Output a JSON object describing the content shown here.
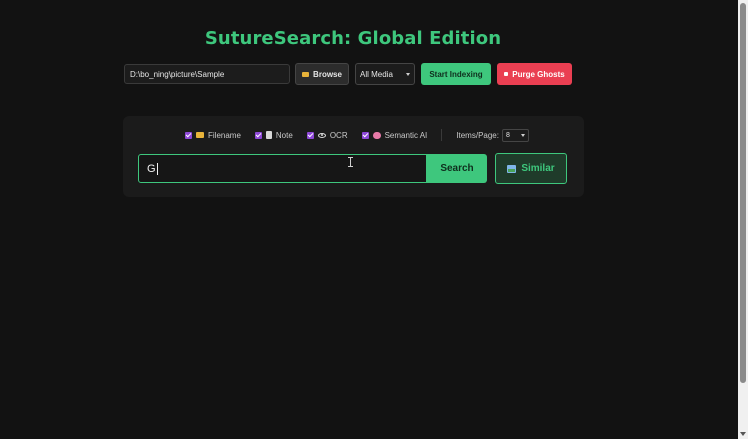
{
  "app": {
    "title": "SutureSearch: Global Edition"
  },
  "toolbar": {
    "path_value": "D:\\bo_ning\\picture\\Sample",
    "browse_label": "Browse",
    "media_selected": "All Media",
    "start_label": "Start Indexing",
    "purge_label": "Purge Ghosts"
  },
  "filters": [
    {
      "label": "Filename",
      "checked": true,
      "icon": "folder-icon"
    },
    {
      "label": "Note",
      "checked": true,
      "icon": "document-icon"
    },
    {
      "label": "OCR",
      "checked": true,
      "icon": "eye-icon"
    },
    {
      "label": "Semantic AI",
      "checked": true,
      "icon": "brain-icon"
    }
  ],
  "pagination": {
    "items_label": "Items/Page:",
    "items_selected": "8"
  },
  "search": {
    "query": "G",
    "search_label": "Search",
    "similar_label": "Similar"
  },
  "colors": {
    "accent": "#3ec77d",
    "danger": "#ea3f52",
    "checkbox": "#8d47d6",
    "background": "#121212"
  }
}
